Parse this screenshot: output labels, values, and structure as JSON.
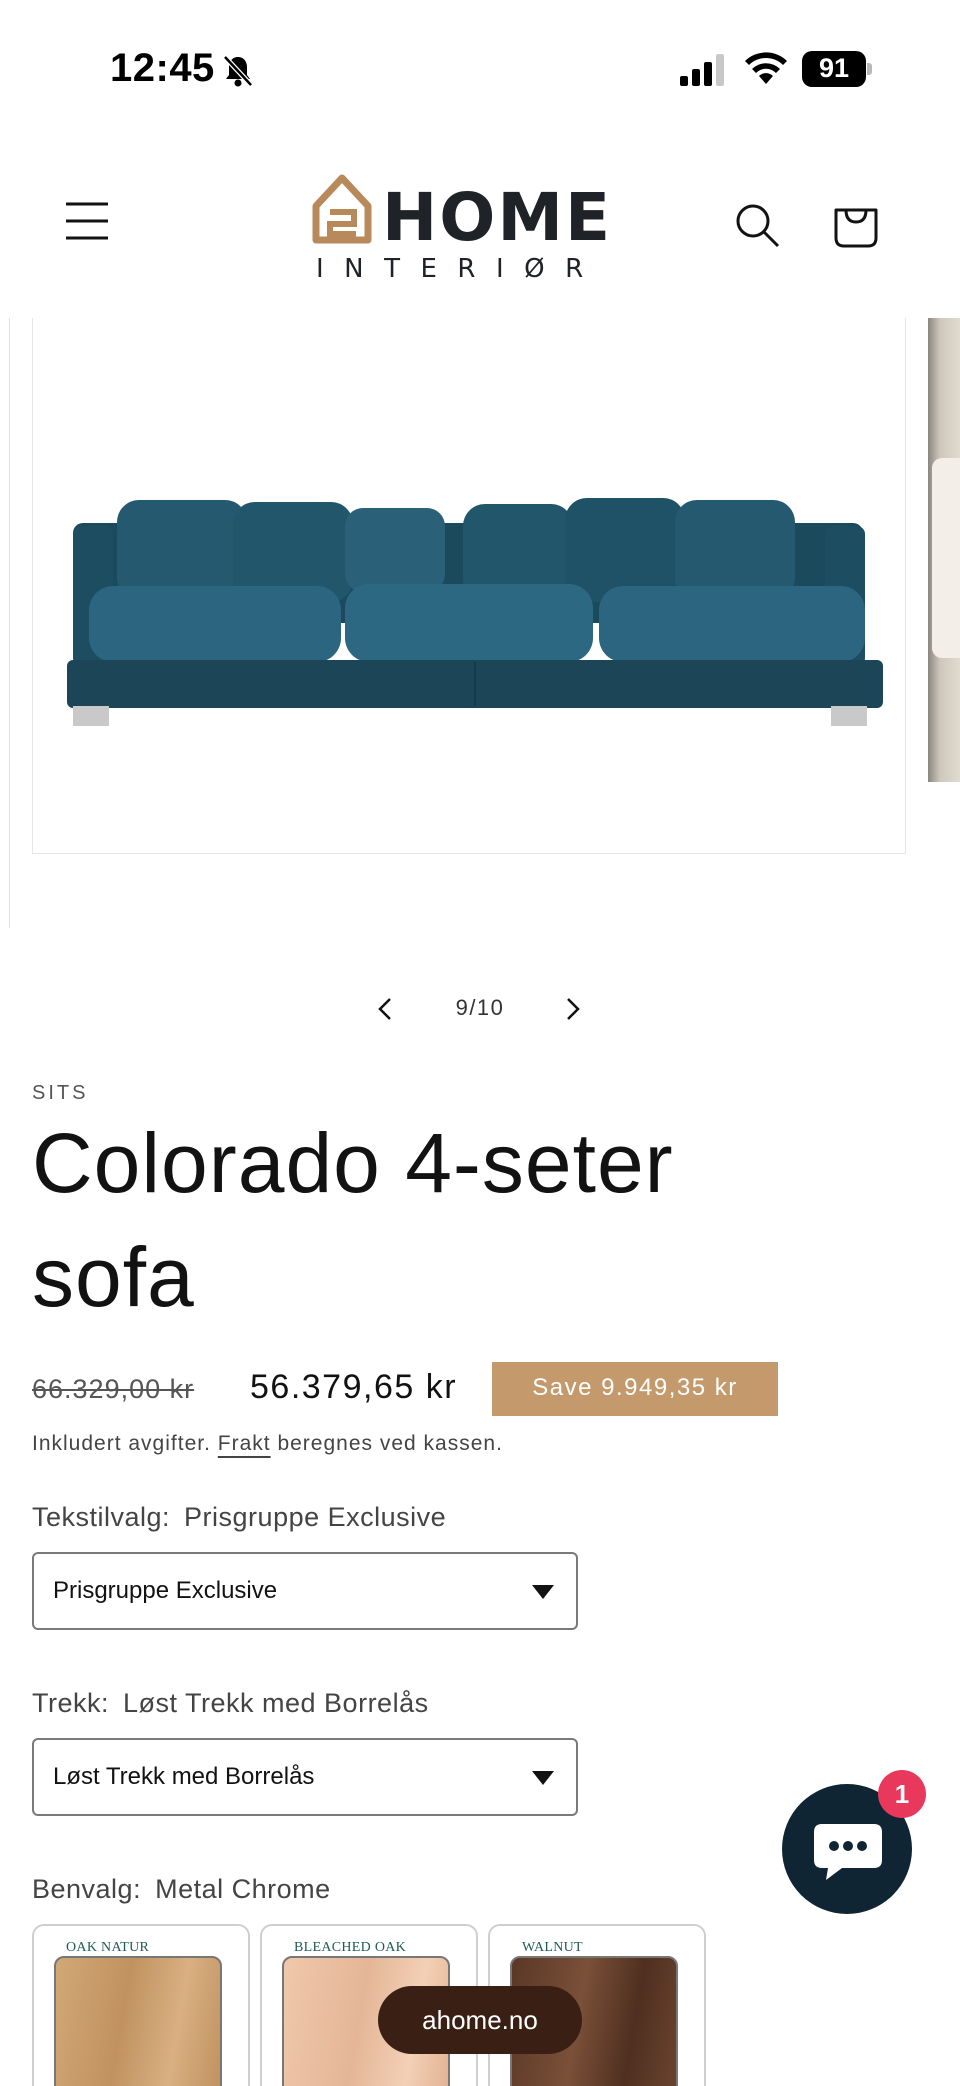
{
  "status_bar": {
    "time": "12:45",
    "battery": "91",
    "icons": [
      "bell-slash-icon",
      "signal-icon",
      "wifi-icon",
      "battery-icon"
    ]
  },
  "header": {
    "logo_text": "HOME",
    "logo_subtext": "INTERIØR",
    "icons": [
      "menu-icon",
      "search-icon",
      "cart-icon"
    ],
    "logo_color": "#b8895a"
  },
  "gallery": {
    "counter": "9/10",
    "prev_icon": "chevron-left-icon",
    "next_icon": "chevron-right-icon",
    "sofa_color": "#1e4f63"
  },
  "product": {
    "vendor": "SITS",
    "title": "Colorado 4-seter sofa",
    "price_compare": "66.329,00 kr",
    "price_sale": "56.379,65 kr",
    "save_badge": "Save 9.949,35 kr",
    "tax_note_prefix": "Inkludert avgifter.",
    "tax_note_link": "Frakt",
    "tax_note_suffix": "beregnes ved kassen."
  },
  "options": {
    "fabric": {
      "label": "Tekstilvalg:",
      "value": "Prisgruppe Exclusive",
      "selected": "Prisgruppe Exclusive"
    },
    "cover": {
      "label": "Trekk:",
      "value": "Løst Trekk med Borrelås",
      "selected": "Løst Trekk med Borrelås"
    },
    "legs": {
      "label": "Benvalg:",
      "value": "Metal Chrome",
      "swatches": [
        {
          "label": "OAK NATUR",
          "color": "#c69a6a"
        },
        {
          "label": "BLEACHED OAK",
          "color": "#e9bfa2"
        },
        {
          "label": "WALNUT",
          "color": "#6a4430"
        }
      ]
    }
  },
  "chat": {
    "badge": "1",
    "icon": "chat-bubble-icon",
    "color": "#0f2534",
    "badge_color": "#e8385b"
  },
  "browser": {
    "url": "ahome.no"
  },
  "colors": {
    "accent": "#c49a6c",
    "text": "#121212"
  }
}
